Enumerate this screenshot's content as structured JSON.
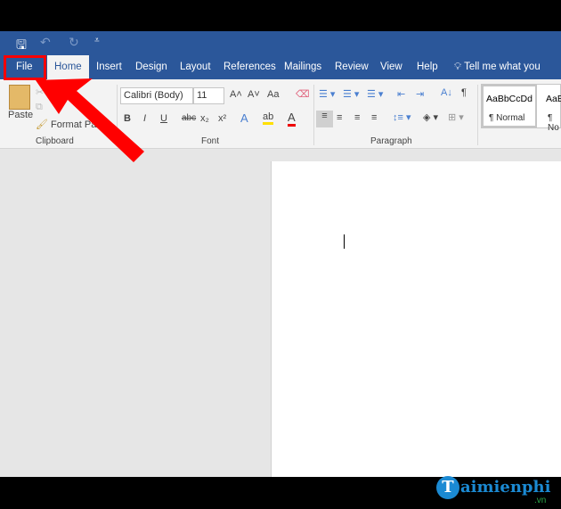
{
  "quick_access": {
    "save": "save-icon",
    "undo": "undo-icon",
    "redo": "redo-icon",
    "customize": "customize-icon"
  },
  "tabs": [
    "File",
    "Home",
    "Insert",
    "Design",
    "Layout",
    "References",
    "Mailings",
    "Review",
    "View",
    "Help"
  ],
  "tell_me": "Tell me what you want",
  "clipboard": {
    "paste": "Paste",
    "format_painter": "Format Painter",
    "group": "Clipboard"
  },
  "font": {
    "name": "Calibri (Body)",
    "size": "11",
    "case": "Aa",
    "bold": "B",
    "italic": "I",
    "underline": "U",
    "strike": "abc",
    "sub": "x₂",
    "sup": "x²",
    "color_letter": "A",
    "group": "Font"
  },
  "paragraph": {
    "group": "Paragraph",
    "pilcrow": "¶"
  },
  "styles": {
    "preview": "AaBbCcDd",
    "normal": "¶ Normal",
    "preview2": "AaBl",
    "normal2": "¶ No"
  },
  "watermark": {
    "brand": "Taimienphi",
    ".vn": ".vn"
  },
  "colors": {
    "accent": "#2b579a",
    "annotation": "#ff0000"
  }
}
